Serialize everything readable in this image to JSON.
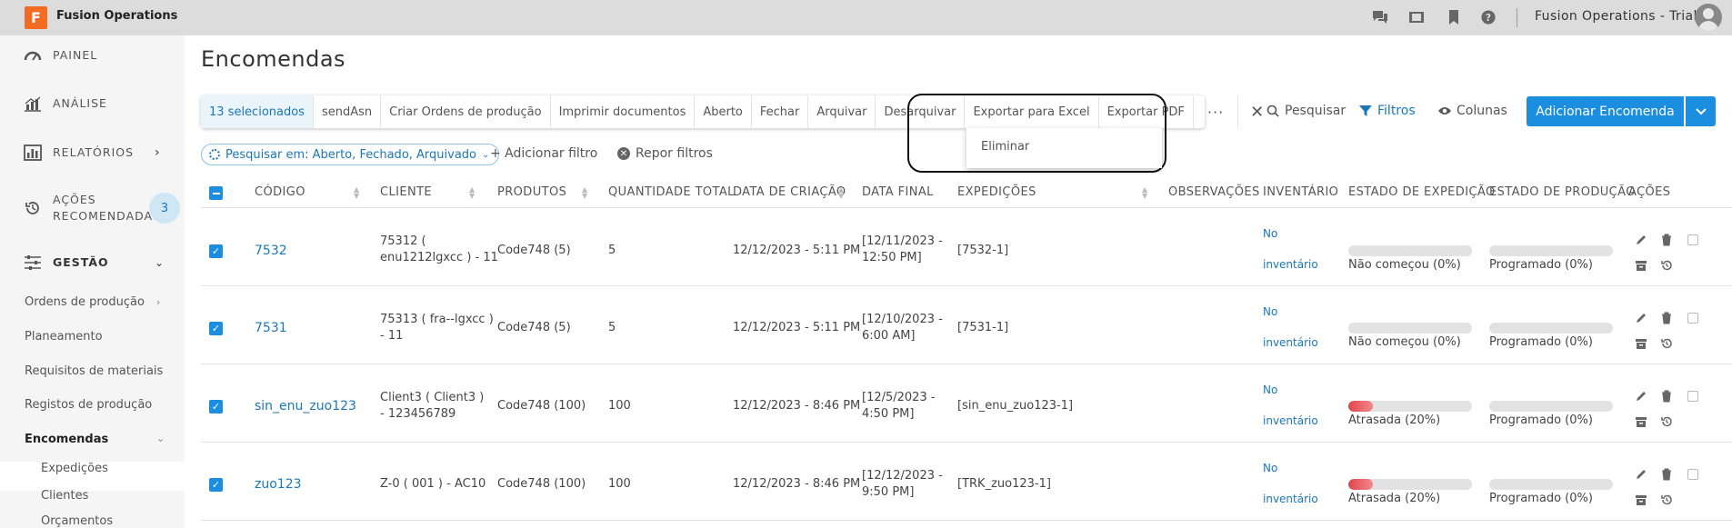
{
  "app": {
    "logo_letter": "F",
    "title": "Fusion Operations",
    "org_name": "Fusion Operations - Trial",
    "top_icons": [
      "chat-icon",
      "film-icon",
      "bookmark-icon",
      "help-icon"
    ]
  },
  "sidebar": {
    "main": [
      {
        "label": "PAINEL",
        "icon": "dashboard-icon"
      },
      {
        "label": "ANÁLISE",
        "icon": "chart-icon"
      },
      {
        "label": "RELATÓRIOS",
        "icon": "reports-icon"
      },
      {
        "label": "AÇÕES RECOMENDADAS",
        "icon": "history-icon",
        "badge": "3"
      },
      {
        "label": "GESTÃO",
        "icon": "sliders-icon"
      }
    ],
    "sub": [
      "Ordens de produção",
      "Planeamento",
      "Requisitos de materiais",
      "Registos de produção",
      "Encomendas"
    ],
    "sub2": [
      "Expedições",
      "Clientes",
      "Orçamentos"
    ]
  },
  "main": {
    "title": "Encomendas",
    "bulk_actions": [
      "13 selecionados",
      "sendAsn",
      "Criar Ordens de produção",
      "Imprimir documentos",
      "Aberto",
      "Fechar",
      "Arquivar",
      "Desarquivar",
      "Exportar para Excel",
      "Exportar PDF",
      "···",
      "✕"
    ],
    "dropdown_item": "Eliminar",
    "tools": {
      "search": "Pesquisar",
      "filters": "Filtros",
      "columns": "Colunas"
    },
    "add_button": "Adicionar Encomenda",
    "filter_chip": "Pesquisar em: Aberto, Fechado, Arquivado",
    "add_filter": "+ Adicionar filtro",
    "reset_filters": "Repor filtros",
    "colors": {
      "accent": "#1b8ee0",
      "link": "#1b77b8",
      "late": "#e2444b"
    }
  },
  "table": {
    "headers": [
      "CÓDIGO",
      "CLIENTE",
      "PRODUTOS",
      "QUANTIDADE TOTAL",
      "DATA DE CRIAÇÃO",
      "DATA FINAL",
      "EXPEDIÇÕES",
      "OBSERVAÇÕES",
      "INVENTÁRIO",
      "ESTADO DE EXPEDIÇÃO",
      "ESTADO DE PRODUÇÃO",
      "AÇÕES"
    ],
    "rows": [
      {
        "code": "7532",
        "client_l1": "75312 (",
        "client_l2": "enu1212lgxcc ) - 11",
        "products": "Code748 (5)",
        "qty": "5",
        "created": "12/12/2023 - 5:11 PM",
        "end_l1": "[12/11/2023 -",
        "end_l2": "12:50 PM]",
        "shipments": "[7532-1]",
        "inv_l1": "No",
        "inv_l2": "inventário",
        "ship_status": "Não começou (0%)",
        "ship_pct": 0,
        "prod_status": "Programado (0%)",
        "prod_pct": 0
      },
      {
        "code": "7531",
        "client_l1": "75313 ( fra--lgxcc )",
        "client_l2": "- 11",
        "products": "Code748 (5)",
        "qty": "5",
        "created": "12/12/2023 - 5:11 PM",
        "end_l1": "[12/10/2023 -",
        "end_l2": "6:00 AM]",
        "shipments": "[7531-1]",
        "inv_l1": "No",
        "inv_l2": "inventário",
        "ship_status": "Não começou (0%)",
        "ship_pct": 0,
        "prod_status": "Programado (0%)",
        "prod_pct": 0
      },
      {
        "code": "sin_enu_zuo123",
        "client_l1": "Client3 ( Client3 )",
        "client_l2": "- 123456789",
        "products": "Code748 (100)",
        "qty": "100",
        "created": "12/12/2023 - 8:46 PM",
        "end_l1": "[12/5/2023 -",
        "end_l2": "4:50 PM]",
        "shipments": "[sin_enu_zuo123-1]",
        "inv_l1": "No",
        "inv_l2": "inventário",
        "ship_status": "Atrasada (20%)",
        "ship_pct": 20,
        "prod_status": "Programado (0%)",
        "prod_pct": 0
      },
      {
        "code": "zuo123",
        "client_l1": "Z-0 ( 001 ) - AC10",
        "client_l2": "",
        "products": "Code748 (100)",
        "qty": "100",
        "created": "12/12/2023 - 8:46 PM",
        "end_l1": "[12/12/2023 -",
        "end_l2": "9:50 PM]",
        "shipments": "[TRK_zuo123-1]",
        "inv_l1": "No",
        "inv_l2": "inventário",
        "ship_status": "Atrasada (20%)",
        "ship_pct": 20,
        "prod_status": "Programado (0%)",
        "prod_pct": 0
      }
    ]
  }
}
